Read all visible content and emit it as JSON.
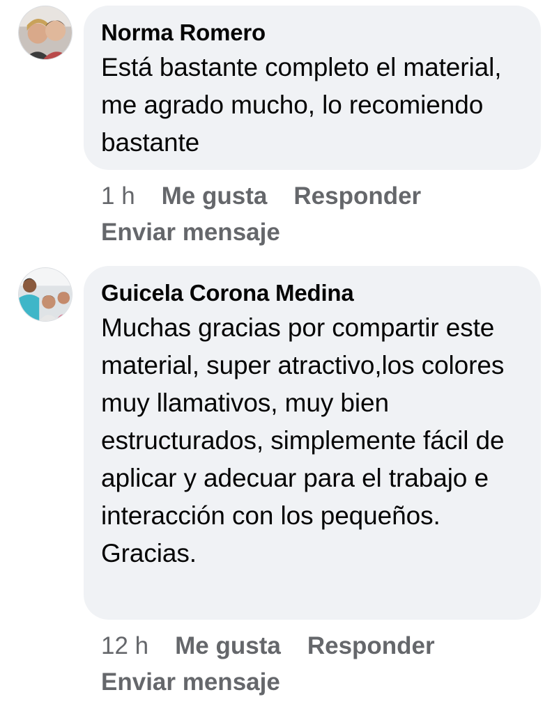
{
  "comments": [
    {
      "author": "Norma Romero",
      "text": "Está bastante completo el material, me agrado mucho, lo recomiendo bastante",
      "time": "1 h",
      "like_label": "Me gusta",
      "reply_label": "Responder",
      "message_label": "Enviar mensaje",
      "avatar_icon": "profile-photo-icon"
    },
    {
      "author": "Guicela Corona Medina",
      "text": "Muchas gracias por compartir este material, super atractivo,los colores muy llamativos, muy bien estructurados, simplemente fácil de aplicar y adecuar para el trabajo e interacción con los pequeños. Gracias.",
      "time": "12 h",
      "like_label": "Me gusta",
      "reply_label": "Responder",
      "message_label": "Enviar mensaje",
      "avatar_icon": "profile-photo-icon"
    }
  ],
  "colors": {
    "bubble_bg": "#f0f2f5",
    "text": "#050505",
    "secondary_text": "#65676b"
  }
}
